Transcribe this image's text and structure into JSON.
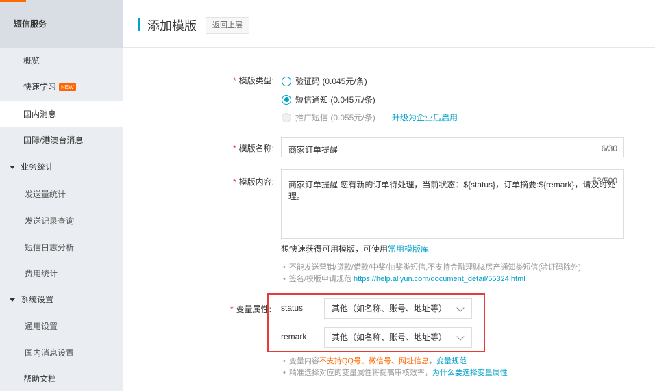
{
  "sidebar": {
    "header": "短信服务",
    "items": {
      "overview": "概览",
      "quick_learn": "快速学习",
      "new_badge": "NEW",
      "domestic": "国内消息",
      "intl": "国际/港澳台消息",
      "business_stats": "业务统计",
      "send_stats": "发送量统计",
      "send_records": "发送记录查询",
      "sms_log": "短信日志分析",
      "cost_stats": "费用统计",
      "system_settings": "系统设置",
      "general_settings": "通用设置",
      "domestic_settings": "国内消息设置",
      "help_docs": "帮助文档"
    }
  },
  "header": {
    "title": "添加模版",
    "back_label": "返回上层"
  },
  "form": {
    "type_label": "模版类型:",
    "types": [
      {
        "label": "验证码 (0.045元/条)",
        "selected": false
      },
      {
        "label": "短信通知 (0.045元/条)",
        "selected": true
      },
      {
        "label": "推广短信 (0.055元/条)",
        "selected": false,
        "disabled": true
      }
    ],
    "upgrade_link": "升级为企业后启用",
    "name_label": "模版名称:",
    "name_value": "商家订单提醒",
    "name_counter": "6/30",
    "content_label": "模版内容:",
    "content_value": "商家订单提醒 您有新的订单待处理，当前状态：${status}，订单摘要:${remark}，请及时处理。",
    "content_counter": "53/500",
    "hint_prefix": "想快速获得可用模版，可使用",
    "hint_link": "常用模版库",
    "rule1": "不能发送营销/贷款/借款/中奖/抽奖类短信,不支持金融理财&房产通知类短信(验证码除外)",
    "rule2_prefix": "签名/模版申请规范",
    "rule2_link": "https://help.aliyun.com/document_detail/55324.html",
    "var_label": "变量属性:",
    "variables": [
      {
        "name": "status",
        "selected": "其他（如名称、账号、地址等）"
      },
      {
        "name": "remark",
        "selected": "其他（如名称、账号、地址等）"
      }
    ],
    "var_note1_prefix": "变量内容",
    "var_note1_warn": "不支持QQ号、微信号、网址信息",
    "var_note1_sep": "，",
    "var_note1_link": "变量规范",
    "var_note2_prefix": "精准选择对应的变量属性将提高审核效率，",
    "var_note2_link": "为什么要选择变量属性"
  },
  "colors": {
    "accent": "#00a2ca",
    "warn": "#ff6600",
    "required": "#e4393c",
    "highlight_box": "#e63b3b"
  }
}
